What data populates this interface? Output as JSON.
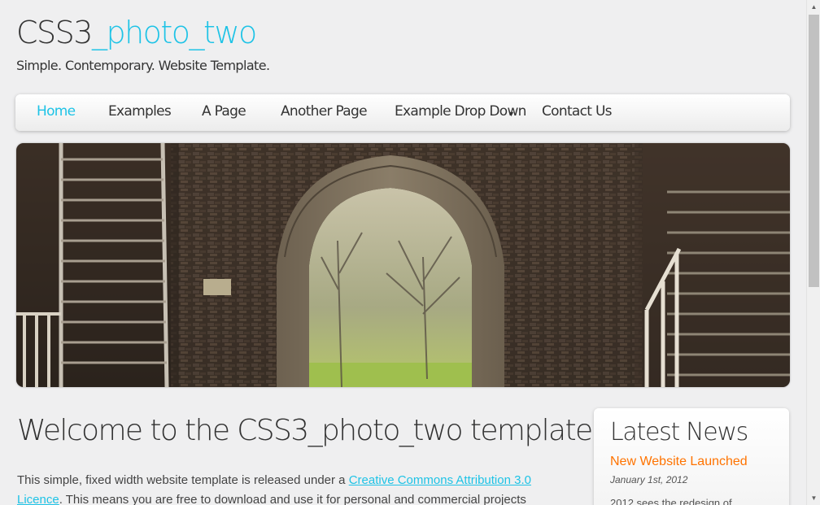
{
  "header": {
    "logo_main": "CSS3",
    "logo_accent": "_photo_two",
    "slogan": "Simple. Contemporary. Website Template."
  },
  "nav": {
    "items": [
      {
        "label": "Home",
        "active": true
      },
      {
        "label": "Examples"
      },
      {
        "label": "A Page"
      },
      {
        "label": "Another Page"
      },
      {
        "label": "Example Drop Down",
        "has_dropdown": true
      },
      {
        "label": "Contact Us"
      }
    ],
    "dropdown_icon": "caret-down-icon",
    "accent_color": "#1ec3e6"
  },
  "banner": {
    "image_subject": "stone archway ruins with wooden staircases"
  },
  "content": {
    "title": "Welcome to the CSS3_photo_two template",
    "p1_before": "This simple, fixed width website template is released under a ",
    "p1_link": "Creative Commons Attribution 3.0",
    "p2_link": "Licence",
    "p2_after": ". This means you are free to download and use it for personal and commercial projects"
  },
  "sidebar": {
    "title": "Latest News",
    "news_headline": "New Website Launched",
    "news_date": "January 1st, 2012",
    "news_text": "2012 sees the redesign of",
    "headline_color": "#ff7300"
  }
}
